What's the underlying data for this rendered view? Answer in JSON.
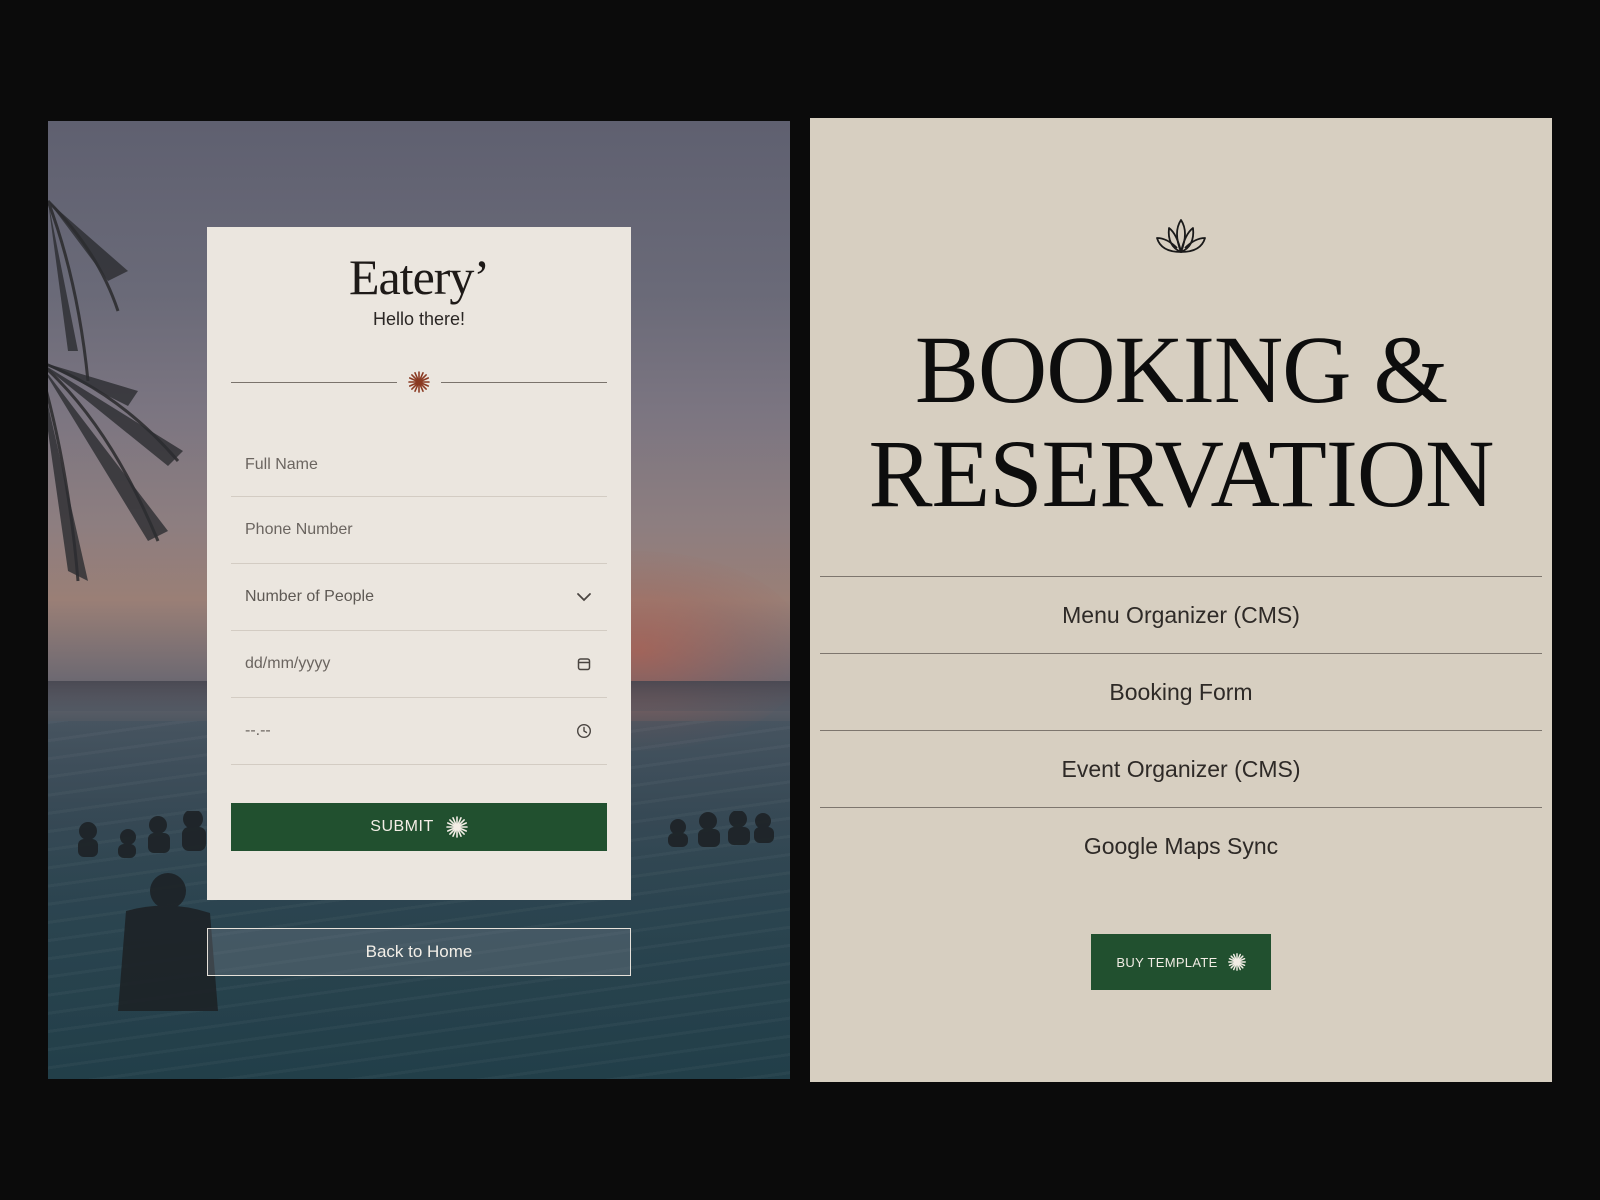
{
  "form": {
    "brand": "Eatery’",
    "greeting": "Hello there!",
    "fields": {
      "full_name_placeholder": "Full Name",
      "phone_placeholder": "Phone Number",
      "people_label": "Number of People",
      "date_placeholder": "dd/mm/yyyy",
      "time_placeholder": "--.--"
    },
    "submit_label": "SUBMIT",
    "back_label": "Back to Home"
  },
  "showcase": {
    "headline_line1": "BOOKING &",
    "headline_line2": "RESERVATION",
    "features": [
      "Menu Organizer (CMS)",
      "Booking Form",
      "Event Organizer (CMS)",
      "Google Maps Sync"
    ],
    "buy_label": "BUY TEMPLATE"
  },
  "colors": {
    "accent_green": "#21502f",
    "star_accent": "#8a3a22",
    "card_bg": "#ebe6df",
    "showcase_bg": "#d7cfc1"
  },
  "icons": {
    "divider": "starburst-icon",
    "people": "chevron-down-icon",
    "date": "calendar-icon",
    "time": "clock-icon",
    "logo": "lotus-icon"
  }
}
